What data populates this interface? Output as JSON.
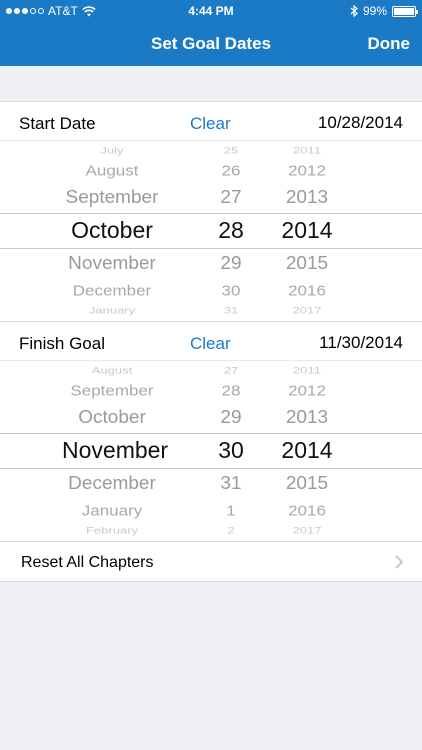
{
  "status_bar": {
    "carrier": "AT&T",
    "time": "4:44 PM",
    "battery": "99%",
    "battery_level": 0.99
  },
  "navbar": {
    "title": "Set Goal Dates",
    "done_label": "Done"
  },
  "start": {
    "label": "Start Date",
    "clear_label": "Clear",
    "value": "10/28/2014",
    "months": [
      "July",
      "August",
      "September",
      "October",
      "November",
      "December",
      "January"
    ],
    "days": [
      "25",
      "26",
      "27",
      "28",
      "29",
      "30",
      "31"
    ],
    "years": [
      "2011",
      "2012",
      "2013",
      "2014",
      "2015",
      "2016",
      "2017"
    ]
  },
  "finish": {
    "label": "Finish Goal",
    "clear_label": "Clear",
    "value": "11/30/2014",
    "months": [
      "August",
      "September",
      "October",
      "November",
      "December",
      "January",
      "February"
    ],
    "days": [
      "27",
      "28",
      "29",
      "30",
      "31",
      "1",
      "2"
    ],
    "years": [
      "2011",
      "2012",
      "2013",
      "2014",
      "2015",
      "2016",
      "2017"
    ]
  },
  "reset": {
    "label": "Reset All Chapters"
  }
}
